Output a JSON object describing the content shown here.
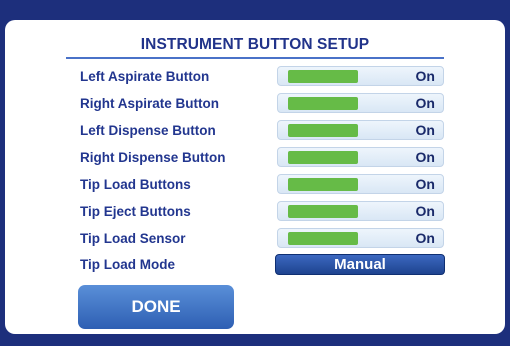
{
  "title": "INSTRUMENT BUTTON SETUP",
  "rows": [
    {
      "label": "Left Aspirate Button",
      "state": "On"
    },
    {
      "label": "Right Aspirate Button",
      "state": "On"
    },
    {
      "label": "Left Dispense Button",
      "state": "On"
    },
    {
      "label": "Right Dispense Button",
      "state": "On"
    },
    {
      "label": "Tip Load Buttons",
      "state": "On"
    },
    {
      "label": "Tip Eject Buttons",
      "state": "On"
    },
    {
      "label": "Tip Load Sensor",
      "state": "On"
    }
  ],
  "tip_load_mode": {
    "label": "Tip Load Mode",
    "value": "Manual"
  },
  "done_label": "DONE",
  "colors": {
    "background": "#1d2f7c",
    "panel": "#ffffff",
    "label_text": "#22368f",
    "toggle_on": "#66bb47",
    "mode_button": "#2a52a6",
    "done_button": "#3f74c6"
  }
}
